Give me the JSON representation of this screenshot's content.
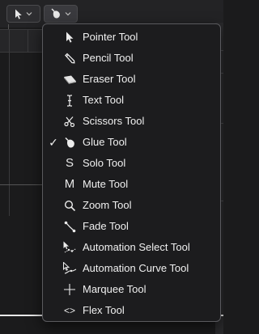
{
  "toolbar": {
    "left_tool_icon": "pointer-icon",
    "right_tool_icon": "glue-icon",
    "dropdown_icon": "chevron-down-icon"
  },
  "menu": {
    "selected_check": "✓",
    "items": [
      {
        "label": "Pointer Tool",
        "icon": "pointer-icon",
        "checked": false
      },
      {
        "label": "Pencil Tool",
        "icon": "pencil-icon",
        "checked": false
      },
      {
        "label": "Eraser Tool",
        "icon": "eraser-icon",
        "checked": false
      },
      {
        "label": "Text Tool",
        "icon": "text-cursor-icon",
        "checked": false
      },
      {
        "label": "Scissors Tool",
        "icon": "scissors-icon",
        "checked": false
      },
      {
        "label": "Glue Tool",
        "icon": "glue-icon",
        "checked": true
      },
      {
        "label": "Solo Tool",
        "icon": "solo-icon",
        "glyph": "S",
        "checked": false
      },
      {
        "label": "Mute Tool",
        "icon": "mute-icon",
        "glyph": "M",
        "checked": false
      },
      {
        "label": "Zoom Tool",
        "icon": "zoom-icon",
        "checked": false
      },
      {
        "label": "Fade Tool",
        "icon": "fade-icon",
        "checked": false
      },
      {
        "label": "Automation Select Tool",
        "icon": "automation-select-icon",
        "checked": false
      },
      {
        "label": "Automation Curve Tool",
        "icon": "automation-curve-icon",
        "checked": false
      },
      {
        "label": "Marquee Tool",
        "icon": "marquee-icon",
        "checked": false
      },
      {
        "label": "Flex Tool",
        "icon": "flex-icon",
        "glyph": "<>",
        "checked": false
      }
    ]
  },
  "colors": {
    "menu_background": "#1c1c1e",
    "menu_border": "#5a5a5e",
    "menu_text": "#f0f0f0",
    "toolbar_button": "#2e2e31"
  }
}
